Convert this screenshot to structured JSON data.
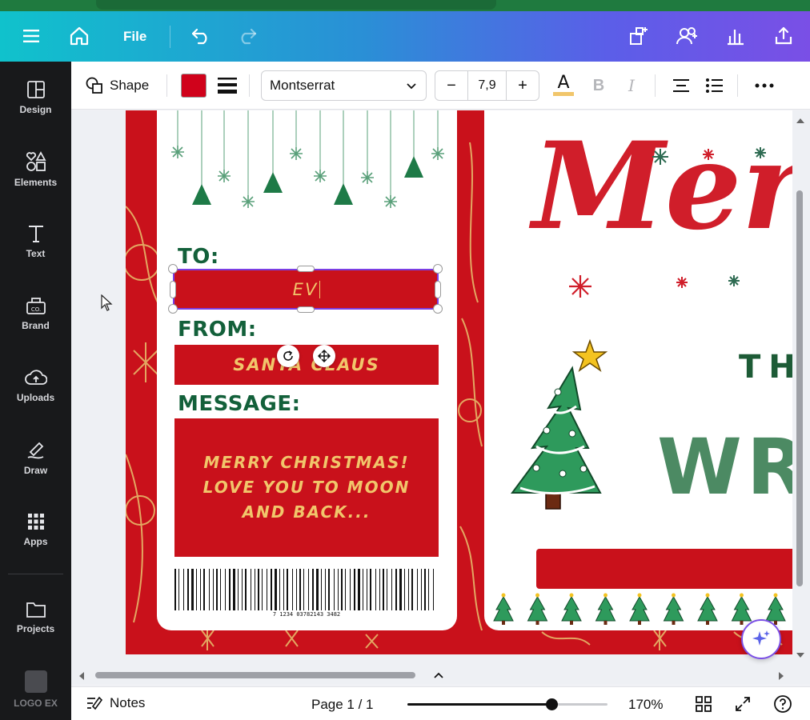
{
  "header": {
    "file_label": "File",
    "icons": [
      "menu-icon",
      "home-icon",
      "undo-icon",
      "redo-icon",
      "resize-icon",
      "share-people-icon",
      "analytics-icon",
      "export-icon"
    ]
  },
  "sidebar": {
    "items": [
      {
        "label": "Design",
        "icon": "design-icon"
      },
      {
        "label": "Elements",
        "icon": "elements-icon"
      },
      {
        "label": "Text",
        "icon": "text-icon"
      },
      {
        "label": "Brand",
        "icon": "brand-icon"
      },
      {
        "label": "Uploads",
        "icon": "upload-icon"
      },
      {
        "label": "Draw",
        "icon": "draw-icon"
      },
      {
        "label": "Apps",
        "icon": "apps-icon"
      },
      {
        "label": "Projects",
        "icon": "folder-icon"
      },
      {
        "label": "LOGO EX",
        "icon": "logo-icon"
      }
    ]
  },
  "toolbar": {
    "shape_label": "Shape",
    "fill_color": "#d0021b",
    "font_name": "Montserrat",
    "font_size": "7,9",
    "decrease": "−",
    "increase": "+",
    "text_color_glyph": "A",
    "bold_glyph": "B",
    "italic_glyph": "I"
  },
  "design": {
    "to_label": "TO:",
    "to_value": "EV",
    "from_label": "FROM:",
    "from_value": "SANTA CLAUS",
    "message_label": "MESSAGE:",
    "message_lines": [
      "MERRY CHRISTMAS!",
      "LOVE YOU TO MOON",
      "AND BACK..."
    ],
    "barcode_number": "7 1234 03782143  3482",
    "merry_text": "Merry",
    "this_text": "THI",
    "wri_text": "WRI",
    "accent_red": "#c9111b",
    "accent_green": "#13603a",
    "accent_gold": "#f1c66b"
  },
  "footer": {
    "notes_label": "Notes",
    "page_label": "Page 1 / 1",
    "zoom_label": "170%",
    "zoom_fraction": 0.72
  }
}
